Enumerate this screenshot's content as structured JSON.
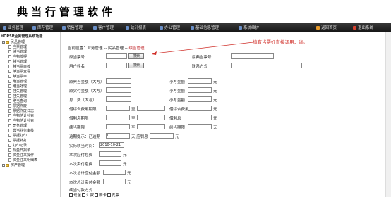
{
  "app_title": "典当行管理软件",
  "nav": {
    "items": [
      "业务管理",
      "库存管理",
      "销售管理",
      "客户管理",
      "统计报表",
      "办公管理",
      "基础信息管理",
      "系统维护",
      "返回首页",
      "退出系统"
    ]
  },
  "sidebar": {
    "title": "HOPSP业务管理系统功能",
    "items": [
      "民品管理",
      "当票管理",
      "续当管理",
      "当物抵押",
      "赎当管理",
      "赎当票审核",
      "续当票查看",
      "赎当票审",
      "绝当管理",
      "绝当处理",
      "挂失管理",
      "挂失管理",
      "绝当查询",
      "票据作废",
      "票据作废日志",
      "当物估计补充",
      "当物估计补充",
      "司务管理",
      "典当业务审核",
      "票据打印",
      "票据补打",
      "打印记录",
      "现金日报单",
      "资金往来操作",
      "资金往来明细表",
      "房产管理"
    ]
  },
  "breadcrumb": {
    "prefix": "当前位置：业务管理 -- 民品管理 -- ",
    "current": "续当管理"
  },
  "callout": "填有当票好直接调用，省。",
  "form": {
    "pawn_no_label": "原当票号",
    "pawn_no_btn": "搜索",
    "orig_no_label": "原典当票号",
    "user_name_label": "用户姓名",
    "user_name_btn": "搜索",
    "contact_label": "联系方式",
    "amt_upper_label": "原典当金额（大写）",
    "amt_small_label": "小写金额",
    "paid_upper_label": "原实付金额（大写）",
    "paid_small_label": "小写金额",
    "fee_upper_label": "息　费（大写）",
    "fee_small_label": "小写金额",
    "rate_label": "借综合费用期限",
    "rate_unit": "至",
    "total_label": "借综合费用",
    "interest_label": "借利息期限",
    "interest_unit": "至",
    "interest_amt_label": "借利息",
    "redeem_label": "续当期限",
    "redeem_unit": "至",
    "redeem_amt_label": "续当期限",
    "redeem_day_unit": "天",
    "overdue_label": "逾期提示：已逾期",
    "overdue_value": "0",
    "overdue_unit": "天 应罚息",
    "penalty_unit": "元",
    "date_label": "实际续当时间：",
    "date_value": "2010-10-21",
    "row_labels": [
      "本次应付息费",
      "本次实付息费",
      "本次总计应付金额",
      "本次总计实付金额"
    ],
    "yuan": "元",
    "pay_method_label": "续当付款方式",
    "methods": [
      "现金",
      "汇款",
      "刷卡",
      "支票"
    ]
  }
}
